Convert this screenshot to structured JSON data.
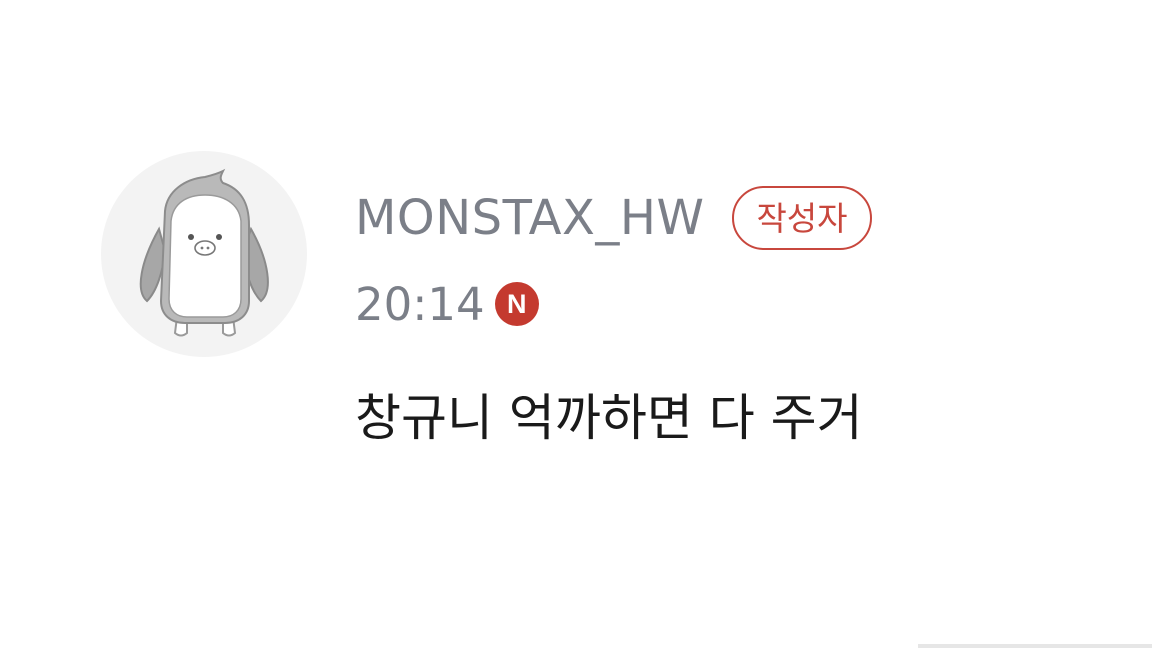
{
  "comment": {
    "author_name": "MONSTAX_HW",
    "author_badge": "작성자",
    "time": "20:14",
    "new_badge": "N",
    "text": "창규니 억까하면 다 주거",
    "avatar_icon": "penguin-icon"
  },
  "colors": {
    "badge_red": "#c8473d",
    "new_badge_bg": "#c43a2f",
    "meta_gray": "#7b7f88",
    "text_black": "#1a1a1a",
    "avatar_bg": "#f3f3f3"
  }
}
